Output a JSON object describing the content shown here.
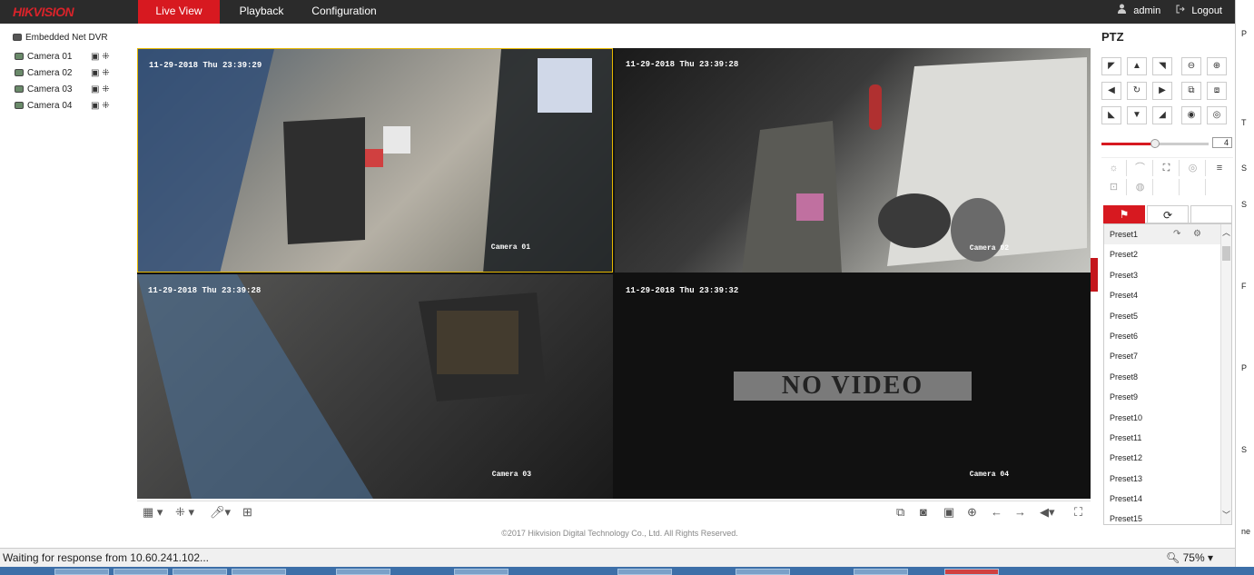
{
  "app": {
    "logo": "HIKVISION"
  },
  "nav": {
    "tabs": [
      {
        "label": "Live View",
        "active": true
      },
      {
        "label": "Playback",
        "active": false
      },
      {
        "label": "Configuration",
        "active": false
      }
    ]
  },
  "user": {
    "name": "admin",
    "logout": "Logout"
  },
  "sidebar": {
    "device": "Embedded Net DVR",
    "cameras": [
      {
        "label": "Camera 01"
      },
      {
        "label": "Camera 02"
      },
      {
        "label": "Camera 03"
      },
      {
        "label": "Camera 04"
      }
    ]
  },
  "video": {
    "panes": [
      {
        "timestamp": "11-29-2018 Thu 23:39:29",
        "label": "Camera 01"
      },
      {
        "timestamp": "11-29-2018 Thu 23:39:28",
        "label": "Camera 02"
      },
      {
        "timestamp": "11-29-2018 Thu 23:39:28",
        "label": "Camera 03"
      },
      {
        "timestamp": "11-29-2018 Thu 23:39:32",
        "label": "Camera 04"
      }
    ],
    "no_video": "NO VIDEO"
  },
  "copyright": "©2017 Hikvision Digital Technology Co., Ltd. All Rights Reserved.",
  "ptz": {
    "title": "PTZ",
    "speed": "4",
    "presets": [
      "Preset1",
      "Preset2",
      "Preset3",
      "Preset4",
      "Preset5",
      "Preset6",
      "Preset7",
      "Preset8",
      "Preset9",
      "Preset10",
      "Preset11",
      "Preset12",
      "Preset13",
      "Preset14",
      "Preset15"
    ]
  },
  "status": {
    "text": "Waiting for response from 10.60.241.102...",
    "zoom": "75%"
  },
  "colors": {
    "accent": "#d71920",
    "topbar": "#2b2b2b",
    "selection": "#e6b800"
  }
}
